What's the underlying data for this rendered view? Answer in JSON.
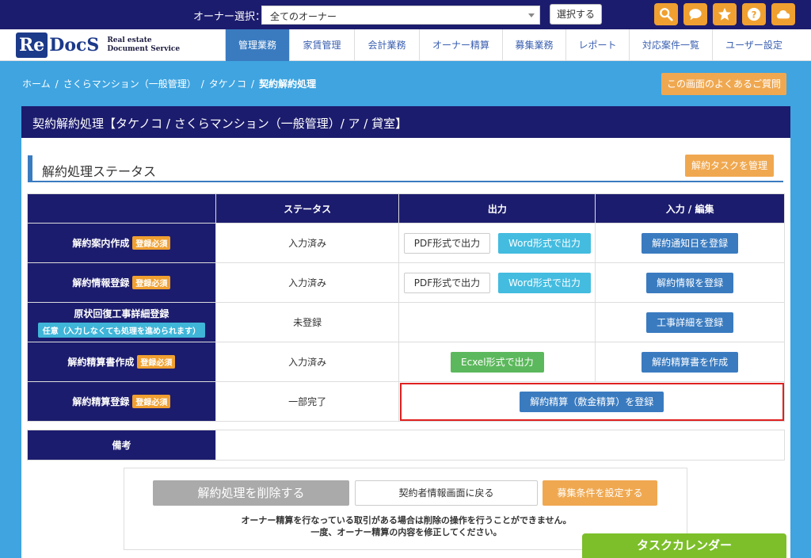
{
  "topbar": {
    "owner_label": "オーナー選択：",
    "owner_select_value": "全てのオーナー",
    "select_button": "選択する",
    "icons": [
      "search-icon",
      "chat-icon",
      "star-icon",
      "help-icon",
      "cloud-icon"
    ],
    "accent_color": "#f0a030"
  },
  "logo": {
    "re": "Re",
    "docs": "DocS",
    "sub1": "Real estate",
    "sub2": "Document Service"
  },
  "nav": {
    "tabs": [
      {
        "label": "管理業務",
        "active": true
      },
      {
        "label": "家賃管理",
        "active": false
      },
      {
        "label": "会計業務",
        "active": false
      },
      {
        "label": "オーナー精算",
        "active": false
      },
      {
        "label": "募集業務",
        "active": false
      },
      {
        "label": "レポート",
        "active": false
      },
      {
        "label": "対応案件一覧",
        "active": false
      },
      {
        "label": "ユーザー設定",
        "active": false
      }
    ]
  },
  "breadcrumb": {
    "items": [
      "ホーム",
      "さくらマンション（一般管理）",
      "タケノコ",
      "契約解約処理"
    ],
    "separator": "/"
  },
  "faq_button": "この画面のよくあるご質問",
  "panel": {
    "title": "契約解約処理【タケノコ / さくらマンション（一般管理）/ ア / 貸室】",
    "section_title": "解約処理ステータス",
    "task_button": "解約タスクを管理"
  },
  "table": {
    "headers": [
      "",
      "ステータス",
      "出力",
      "入力 / 編集"
    ],
    "rows": [
      {
        "name": "解約案内作成",
        "badge": "登録必須",
        "status": "入力済み",
        "output": [
          "PDF形式で出力",
          "Word形式で出力"
        ],
        "action": "解約通知日を登録"
      },
      {
        "name": "解約情報登録",
        "badge": "登録必須",
        "status": "入力済み",
        "output": [
          "PDF形式で出力",
          "Word形式で出力"
        ],
        "action": "解約情報を登録"
      },
      {
        "name": "原状回復工事詳細登録",
        "badge_optional": "任意（入力しなくても処理を進められます）",
        "status": "未登録",
        "action": "工事詳細を登録"
      },
      {
        "name": "解約精算書作成",
        "badge": "登録必須",
        "status": "入力済み",
        "output": [
          "Ecxel形式で出力"
        ],
        "action": "解約精算書を作成"
      },
      {
        "name": "解約精算登録",
        "badge": "登録必須",
        "status": "一部完了",
        "merged_action": "解約精算（敷金精算）を登録"
      }
    ]
  },
  "remarks": {
    "label": "備考",
    "value": ""
  },
  "bottom": {
    "delete_button": "解約処理を削除する",
    "back_button": "契約者情報画面に戻る",
    "recruit_button": "募集条件を設定する",
    "note_line1": "オーナー精算を行なっている取引がある場合は削除の操作を行うことができません。",
    "note_line2": "一度、オーナー精算の内容を修正してください。"
  },
  "calendar_button": "タスクカレンダー"
}
